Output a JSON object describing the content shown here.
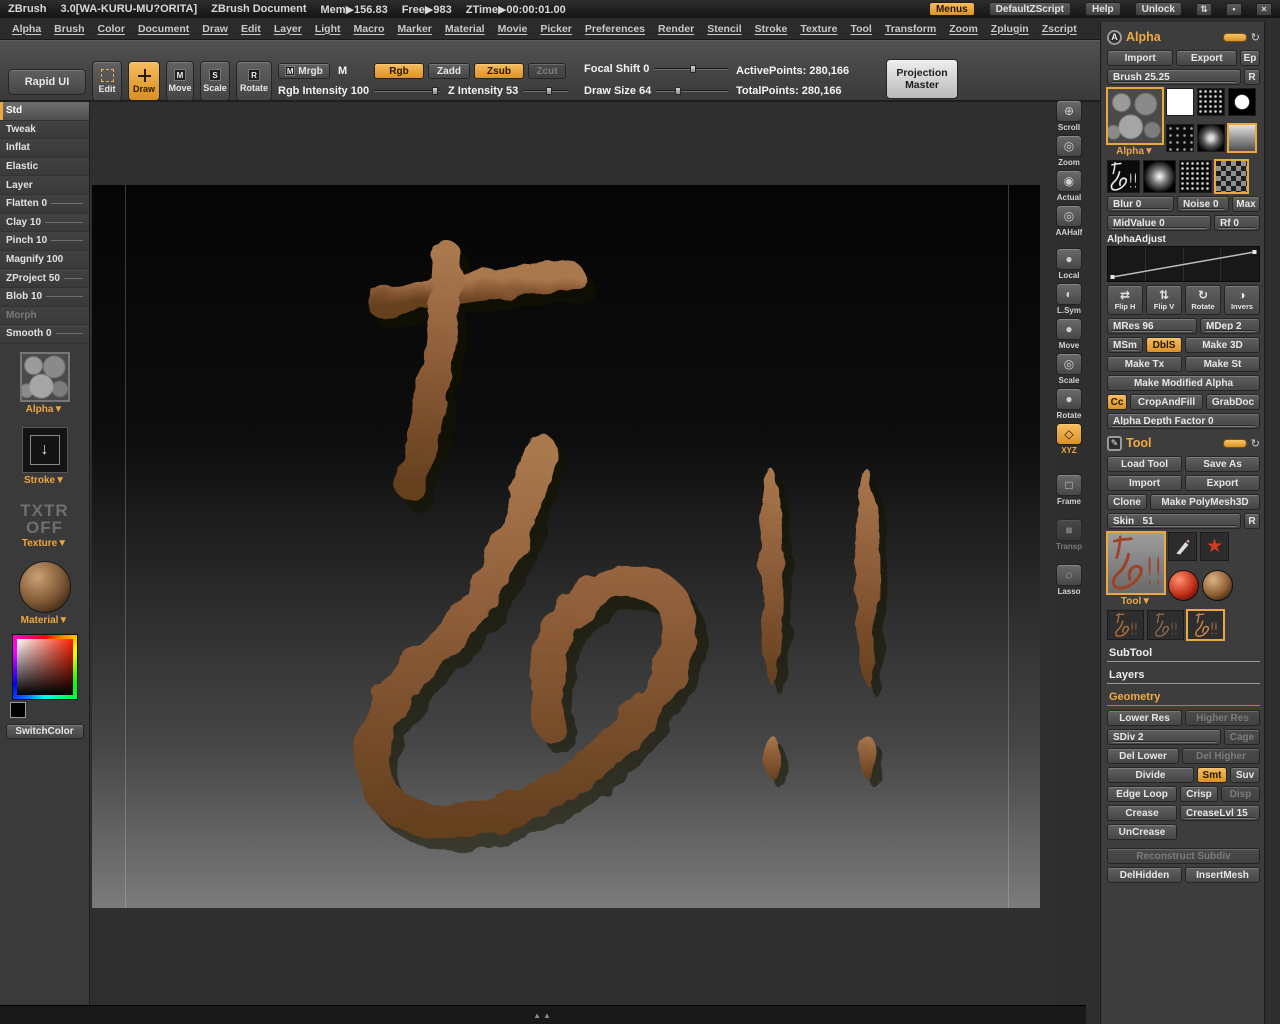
{
  "colors": {
    "accent": "#eda73f",
    "wood": "#8a5a36",
    "canvas_top": "#050505",
    "canvas_bottom": "#7b7b7b"
  },
  "titlebar": {
    "app": "ZBrush",
    "version": "3.0[WA-KURU-MU?ORITA]",
    "document": "ZBrush Document",
    "mem": "Mem▶156.83",
    "free": "Free▶983",
    "ztime": "ZTime▶00:00:01.00",
    "menus": "Menus",
    "default_zscript": "DefaultZScript",
    "help": "Help",
    "unlock": "Unlock",
    "win_icons": [
      "⇅",
      "▪",
      "×"
    ]
  },
  "menubar": {
    "items": [
      "Alpha",
      "Brush",
      "Color",
      "Document",
      "Draw",
      "Edit",
      "Layer",
      "Light",
      "Macro",
      "Marker",
      "Material",
      "Movie",
      "Picker",
      "Preferences",
      "Render",
      "Stencil",
      "Stroke",
      "Texture",
      "Tool",
      "Transform",
      "Zoom",
      "Zplugin",
      "Zscript"
    ]
  },
  "toolbar": {
    "rapid_ui": "Rapid UI",
    "edit": "Edit",
    "draw": "Draw",
    "move": "Move",
    "scale": "Scale",
    "rotate": "Rotate",
    "move_icon": "M",
    "scale_icon": "S",
    "rotate_icon": "R",
    "m_icon": "M",
    "mrgb": "Mrgb",
    "m": "M",
    "rgb": "Rgb",
    "zadd": "Zadd",
    "zsub": "Zsub",
    "zcut": "Zcut",
    "focal_shift": "Focal Shift 0",
    "draw_size": "Draw Size 64",
    "rgb_intensity": "Rgb Intensity 100",
    "z_intensity": "Z Intensity 53",
    "active_points": "ActivePoints: 280,166",
    "total_points": "TotalPoints: 280,166",
    "projection_master_1": "Projection",
    "projection_master_2": "Master"
  },
  "left_sidebar": {
    "brushes": [
      {
        "label": "Std"
      },
      {
        "label": "Tweak"
      },
      {
        "label": "Inflat"
      },
      {
        "label": "Elastic"
      },
      {
        "label": "Layer"
      },
      {
        "label": "Flatten 0"
      },
      {
        "label": "Clay 10"
      },
      {
        "label": "Pinch 10"
      },
      {
        "label": "Magnify 100"
      },
      {
        "label": "ZProject 50"
      },
      {
        "label": "Blob 10"
      },
      {
        "label": "Morph"
      },
      {
        "label": "Smooth 0"
      }
    ],
    "alpha_label": "Alpha▼",
    "stroke_label": "Stroke▼",
    "stroke_icon": "↓",
    "txtr_line1": "TXTR",
    "txtr_line2": "OFF",
    "texture_label": "Texture▼",
    "material_label": "Material▼",
    "switch_color": "SwitchColor"
  },
  "nav_strip": {
    "items": [
      {
        "label": "Scroll",
        "glyph": "⊕"
      },
      {
        "label": "Zoom",
        "glyph": "◎"
      },
      {
        "label": "Actual",
        "glyph": "◉"
      },
      {
        "label": "AAHalf",
        "glyph": "◎"
      },
      {
        "label": "Local",
        "glyph": "●"
      },
      {
        "label": "L.Sym",
        "glyph": "◐"
      },
      {
        "label": "Move",
        "glyph": "●"
      },
      {
        "label": "Scale",
        "glyph": "◎"
      },
      {
        "label": "Rotate",
        "glyph": "●"
      },
      {
        "label": "XYZ",
        "glyph": "◇"
      },
      {
        "label": "Frame",
        "glyph": "□"
      },
      {
        "label": "Transp",
        "glyph": "■"
      },
      {
        "label": "Lasso",
        "glyph": "◌"
      }
    ]
  },
  "alpha_panel": {
    "title": "Alpha",
    "icon": "A",
    "restore_icon": "↻",
    "import": "Import",
    "export": "Export",
    "ep": "Ep",
    "brush_slider": "Brush 25.25",
    "r": "R",
    "selector_label": "Alpha▼",
    "blur": "Blur 0",
    "noise": "Noise 0",
    "max": "Max",
    "midvalue": "MidValue 0",
    "rf": "Rf 0",
    "alphaadjust": "AlphaAdjust",
    "flip_h": "Flip H",
    "flip_v": "Flip V",
    "rotate": "Rotate",
    "invers": "Invers",
    "flip_h_icon": "⇄",
    "flip_v_icon": "⇅",
    "rotate_icon": "↻",
    "invers_icon": "◑",
    "mres": "MRes 96",
    "mdep": "MDep 2",
    "msm": "MSm",
    "dbls": "DblS",
    "make_3d": "Make 3D",
    "make_tx": "Make Tx",
    "make_st": "Make St",
    "make_modified": "Make Modified Alpha",
    "cc": "Cc",
    "crop_and_fill": "CropAndFill",
    "grab_doc": "GrabDoc",
    "depth_factor": "Alpha Depth Factor 0"
  },
  "tool_panel": {
    "title": "Tool",
    "icon": "✎",
    "restore_icon": "↻",
    "load_tool": "Load Tool",
    "save_as": "Save As",
    "import": "Import",
    "export": "Export",
    "clone": "Clone",
    "make_polymesh": "Make PolyMesh3D",
    "skin": "Skin_ 51",
    "r": "R",
    "selector_label": "Tool▼",
    "star_icon": "★",
    "subtool": "SubTool",
    "layers": "Layers",
    "geometry": "Geometry",
    "lower_res": "Lower Res",
    "higher_res": "Higher Res",
    "sdiv": "SDiv 2",
    "cage": "Cage",
    "del_lower": "Del Lower",
    "del_higher": "Del Higher",
    "divide": "Divide",
    "smt": "Smt",
    "suv": "Suv",
    "edge_loop": "Edge Loop",
    "crisp": "Crisp",
    "disp": "Disp",
    "crease": "Crease",
    "crease_lvl": "CreaseLvl 15",
    "uncrease": "UnCrease",
    "reconstruct": "Reconstruct Subdiv",
    "del_hidden": "DelHidden",
    "insert_mesh": "InsertMesh"
  },
  "canvas": {
    "sculpture_text": "あ!!"
  },
  "bottom": {
    "handle": "▲▲"
  }
}
